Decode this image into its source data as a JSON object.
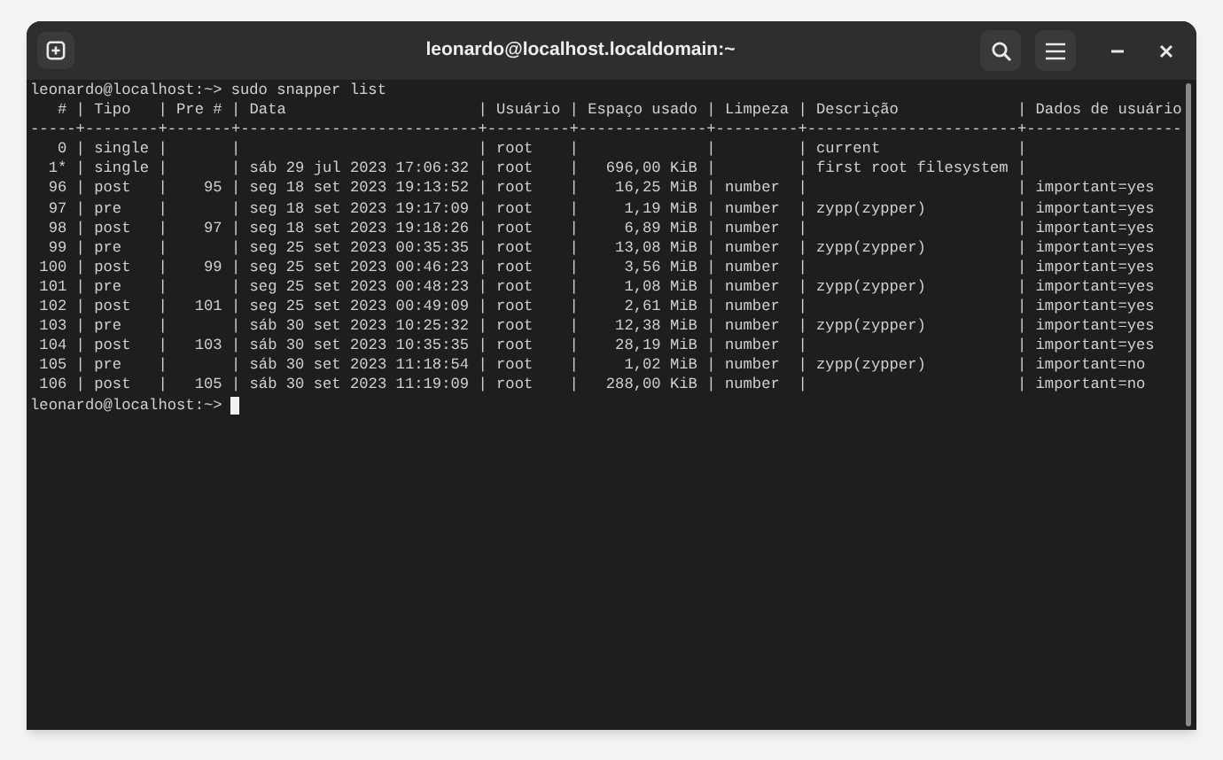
{
  "window": {
    "title": "leonardo@localhost.localdomain:~"
  },
  "terminal": {
    "command_line": {
      "prompt": "leonardo@localhost:~>",
      "command": "sudo snapper list"
    },
    "output_lines": [
      "   # | Tipo   | Pre # | Data                     | Usuário | Espaço usado | Limpeza | Descrição             | Dados de usuário",
      "-----+--------+-------+--------------------------+---------+--------------+---------+-----------------------+-----------------",
      "   0 | single |       |                          | root    |              |         | current               |",
      "  1* | single |       | sáb 29 jul 2023 17:06:32 | root    |   696,00 KiB |         | first root filesystem |",
      "  96 | post   |    95 | seg 18 set 2023 19:13:52 | root    |    16,25 MiB | number  |                       | important=yes",
      "  97 | pre    |       | seg 18 set 2023 19:17:09 | root    |     1,19 MiB | number  | zypp(zypper)          | important=yes",
      "  98 | post   |    97 | seg 18 set 2023 19:18:26 | root    |     6,89 MiB | number  |                       | important=yes",
      "  99 | pre    |       | seg 25 set 2023 00:35:35 | root    |    13,08 MiB | number  | zypp(zypper)          | important=yes",
      " 100 | post   |    99 | seg 25 set 2023 00:46:23 | root    |     3,56 MiB | number  |                       | important=yes",
      " 101 | pre    |       | seg 25 set 2023 00:48:23 | root    |     1,08 MiB | number  | zypp(zypper)          | important=yes",
      " 102 | post   |   101 | seg 25 set 2023 00:49:09 | root    |     2,61 MiB | number  |                       | important=yes",
      " 103 | pre    |       | sáb 30 set 2023 10:25:32 | root    |    12,38 MiB | number  | zypp(zypper)          | important=yes",
      " 104 | post   |   103 | sáb 30 set 2023 10:35:35 | root    |    28,19 MiB | number  |                       | important=yes",
      " 105 | pre    |       | sáb 30 set 2023 11:18:54 | root    |     1,02 MiB | number  | zypp(zypper)          | important=no",
      " 106 | post   |   105 | sáb 30 set 2023 11:19:09 | root    |   288,00 KiB | number  |                       | important=no"
    ],
    "prompt_line": {
      "prompt": "leonardo@localhost:~>"
    }
  }
}
